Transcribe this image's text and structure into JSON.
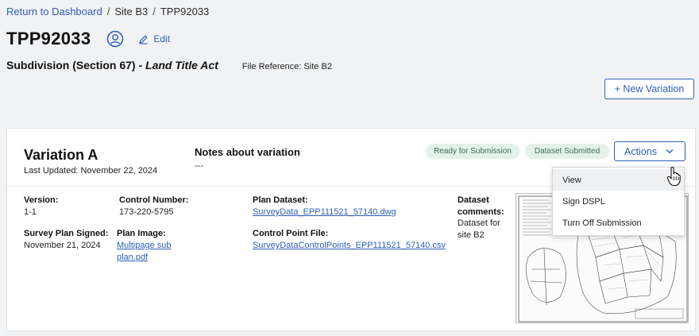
{
  "breadcrumb": {
    "link": "Return to Dashboard",
    "separator": "/",
    "site": "Site B3",
    "current": "TPP92033"
  },
  "header": {
    "title": "TPP92033",
    "edit_label": "Edit",
    "subtitle_prefix": "Subdivision (Section 67) - ",
    "subtitle_italic": "Land Title Act",
    "file_reference": "File Reference: Site B2",
    "new_variation_label": "+ New Variation"
  },
  "variation": {
    "title": "Variation A",
    "last_updated": "Last Updated: November 22, 2024",
    "notes_title": "Notes about variation",
    "notes_value": "---",
    "badges": {
      "ready": "Ready for Submission",
      "submitted": "Dataset Submitted"
    },
    "actions_label": "Actions",
    "fields": {
      "version_label": "Version:",
      "version_value": "1-1",
      "control_number_label": "Control Number:",
      "control_number_value": "173-220-5795",
      "plan_dataset_label": "Plan Dataset:",
      "plan_dataset_value": "SurveyData_EPP111521_57140.dwg",
      "dataset_comments_label_1": "Dataset",
      "dataset_comments_label_2": "comments:",
      "dataset_comments_value_1": "Dataset for",
      "dataset_comments_value_2": "site B2",
      "survey_signed_label": "Survey Plan Signed:",
      "survey_signed_value": "November 21, 2024",
      "plan_image_label": "Plan Image:",
      "plan_image_value_1": "Multipage sub",
      "plan_image_value_2": "plan.pdf",
      "control_point_label": "Control Point File:",
      "control_point_value": "SurveyDataControlPoints_EPP111521_57140.csv"
    }
  },
  "actions_menu": {
    "items": [
      "View",
      "Sign DSPL",
      "Turn Off Submission"
    ]
  },
  "colors": {
    "link": "#2d5fb6",
    "badge_bg": "#e3f1ea",
    "badge_text": "#3f6e57",
    "page_bg": "#f1f2f4"
  }
}
